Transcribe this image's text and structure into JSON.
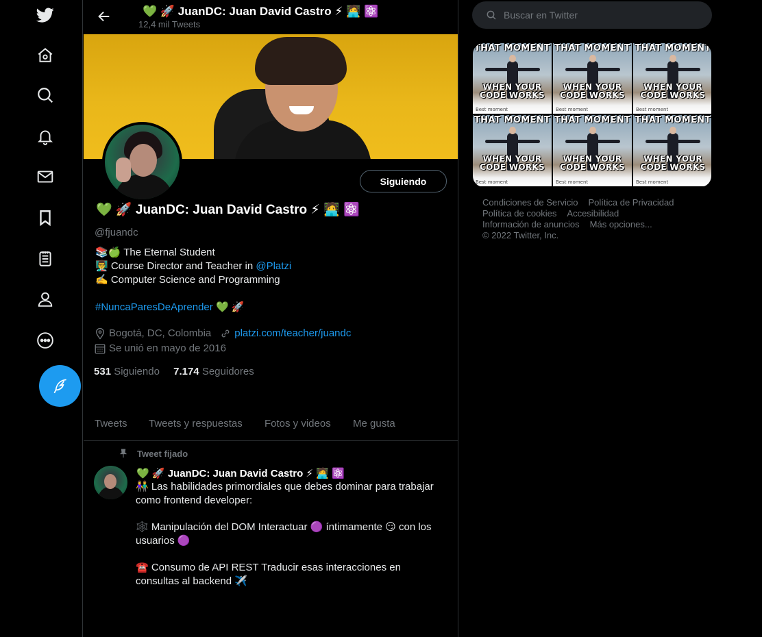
{
  "nav": {
    "items": [
      "twitter-logo",
      "home",
      "explore",
      "notifications",
      "messages",
      "bookmarks",
      "lists",
      "profile",
      "more"
    ]
  },
  "header": {
    "name_prefix": "💚 🚀",
    "name": "JuanDC: Juan David Castro",
    "name_suffix": "⚡ 🧑‍💻 ⚛️",
    "tweet_count": "12,4 mil Tweets"
  },
  "profile": {
    "follow_button": "Siguiendo",
    "name_prefix": "💚 🚀",
    "name": "JuanDC: Juan David Castro",
    "name_suffix": "⚡ 🧑‍💻 ⚛️",
    "handle": "@fjuandc",
    "bio": {
      "line1": "📚🍏 The Eternal Student",
      "line2_prefix": "👨‍🏫 Course Director and Teacher in ",
      "line2_mention": "@Platzi",
      "line3": "✍️ Computer Science and Programming",
      "hashtag": "#NuncaParesDeAprender",
      "hashtag_suffix": " 💚 🚀"
    },
    "location": "Bogotá, DC, Colombia",
    "website": "platzi.com/teacher/juandc",
    "joined": "Se unió en mayo de 2016",
    "following_count": "531",
    "following_label": "Siguiendo",
    "followers_count": "7.174",
    "followers_label": "Seguidores"
  },
  "tabs": [
    "Tweets",
    "Tweets y respuestas",
    "Fotos y videos",
    "Me gusta"
  ],
  "pinned_tweet": {
    "label": "Tweet fijado",
    "author_prefix": "💚 🚀",
    "author": "JuanDC: Juan David Castro",
    "author_suffix": "⚡ 🧑‍💻 ⚛️",
    "para1": "👫 Las habilidades primordiales que debes dominar para trabajar como frontend developer:",
    "para2": "🕸️ Manipulación del DOM Interactuar 🟣 íntimamente 😏 con los usuarios 🟣",
    "para3": "☎️ Consumo de API REST Traducir esas interacciones en consultas al backend ✈️"
  },
  "search": {
    "placeholder": "Buscar en Twitter"
  },
  "media": {
    "top_text": "THAT MOMENT",
    "bottom_text": "WHEN YOUR CODE WORKS",
    "caption": "Best moment"
  },
  "footer": {
    "terms": "Condiciones de Servicio",
    "privacy": "Política de Privacidad",
    "cookies": "Política de cookies",
    "accessibility": "Accesibilidad",
    "ads": "Información de anuncios",
    "more": "Más opciones...",
    "copyright": "© 2022 Twitter, Inc."
  },
  "colors": {
    "accent": "#1d9bf0",
    "background": "#000000",
    "muted": "#71767b",
    "green_heart": "#00ba7c"
  }
}
